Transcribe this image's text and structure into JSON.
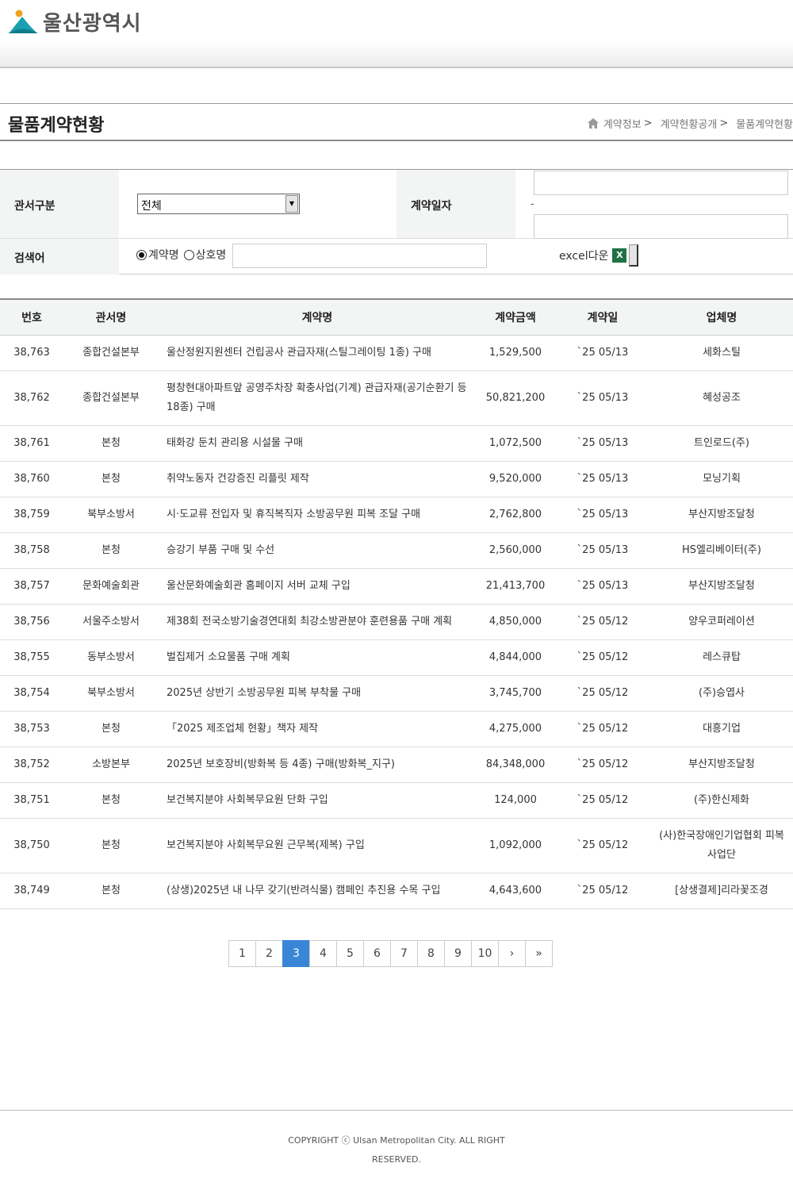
{
  "header": {
    "logo_text": "울산광역시"
  },
  "page": {
    "title": "물품계약현황",
    "breadcrumb": [
      "계약정보",
      "계약현황공개",
      "물품계약현황"
    ],
    "breadcrumb_sep": ">"
  },
  "search": {
    "dept_label": "관서구분",
    "dept_selected": "전체",
    "date_label": "계약일자",
    "date_separator": "-",
    "keyword_label": "검색어",
    "radio_contract": "계약명",
    "radio_company": "상호명",
    "excel_label": "excel다운",
    "excel_icon": "X"
  },
  "table": {
    "headers": [
      "번호",
      "관서명",
      "계약명",
      "계약금액",
      "계약일",
      "업체명"
    ],
    "rows": [
      [
        "38,763",
        "종합건설본부",
        "울산정원지원센터 건립공사 관급자재(스틸그레이팅 1종) 구매",
        "1,529,500",
        "`25 05/13",
        "세화스틸"
      ],
      [
        "38,762",
        "종합건설본부",
        "평창현대아파트앞 공영주차장 확충사업(기계) 관급자재(공기순환기 등 18종) 구매",
        "50,821,200",
        "`25 05/13",
        "혜성공조"
      ],
      [
        "38,761",
        "본청",
        "태화강 둔치 관리용 시설물 구매",
        "1,072,500",
        "`25 05/13",
        "트인로드(주)"
      ],
      [
        "38,760",
        "본청",
        "취약노동자 건강증진 리플릿 제작",
        "9,520,000",
        "`25 05/13",
        "모닝기획"
      ],
      [
        "38,759",
        "북부소방서",
        "시·도교류 전입자 및 휴직복직자 소방공무원 피복 조달 구매",
        "2,762,800",
        "`25 05/13",
        "부산지방조달청"
      ],
      [
        "38,758",
        "본청",
        "승강기 부품 구매 및 수선",
        "2,560,000",
        "`25 05/13",
        "HS엘리베이터(주)"
      ],
      [
        "38,757",
        "문화예술회관",
        "울산문화예술회관 홈페이지 서버 교체 구입",
        "21,413,700",
        "`25 05/13",
        "부산지방조달청"
      ],
      [
        "38,756",
        "서울주소방서",
        "제38회 전국소방기술경연대회 최강소방관분야 훈련용품 구매 계획",
        "4,850,000",
        "`25 05/12",
        "양우코퍼레이션"
      ],
      [
        "38,755",
        "동부소방서",
        "벌집제거 소요물품 구매 계획",
        "4,844,000",
        "`25 05/12",
        "레스큐탑"
      ],
      [
        "38,754",
        "북부소방서",
        "2025년 상반기 소방공무원 피복 부착물 구매",
        "3,745,700",
        "`25 05/12",
        "(주)승엽사"
      ],
      [
        "38,753",
        "본청",
        "「2025 제조업체 현황」책자 제작",
        "4,275,000",
        "`25 05/12",
        "대흥기업"
      ],
      [
        "38,752",
        "소방본부",
        "2025년 보호장비(방화복 등 4종) 구매(방화복_지구)",
        "84,348,000",
        "`25 05/12",
        "부산지방조달청"
      ],
      [
        "38,751",
        "본청",
        "보건복지분야 사회복무요원 단화 구입",
        "124,000",
        "`25 05/12",
        "(주)한신제화"
      ],
      [
        "38,750",
        "본청",
        "보건복지분야 사회복무요원 근무복(제복) 구입",
        "1,092,000",
        "`25 05/12",
        "(사)한국장애인기업협회 피복사업단"
      ],
      [
        "38,749",
        "본청",
        "(상생)2025년 내 나무 갖기(반려식물) 캠페인 추진용 수목 구입",
        "4,643,600",
        "`25 05/12",
        "[상생결제]리라꽃조경"
      ]
    ]
  },
  "pagination": {
    "pages": [
      "1",
      "2",
      "3",
      "4",
      "5",
      "6",
      "7",
      "8",
      "9",
      "10"
    ],
    "current": "3",
    "next": "›",
    "last": "»"
  },
  "footer": {
    "copyright": "COPYRIGHT ⓒ Ulsan Metropolitan City. ALL RIGHT RESERVED."
  },
  "colors": {
    "accent": "#3a86d6",
    "header_bg": "#f3f5f5",
    "excel": "#1f7246"
  }
}
